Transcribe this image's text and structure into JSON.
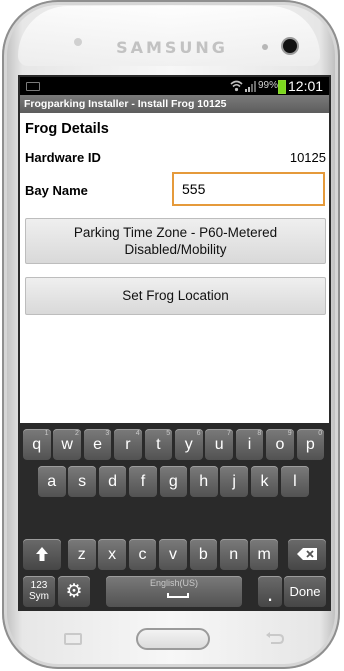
{
  "device": {
    "brand": "SAMSUNG"
  },
  "status_bar": {
    "battery": "99%",
    "time": "12:01"
  },
  "app": {
    "title": "Frogparking Installer - Install Frog 10125"
  },
  "form": {
    "section_title": "Frog Details",
    "hardware_id_label": "Hardware ID",
    "hardware_id_value": "10125",
    "bay_name_label": "Bay Name",
    "bay_name_value": "555"
  },
  "buttons": {
    "zone_line1": "Parking Time Zone - P60-Metered",
    "zone_line2": "Disabled/Mobility",
    "set_location": "Set Frog Location"
  },
  "keyboard": {
    "row1": [
      {
        "k": "q",
        "s": "1"
      },
      {
        "k": "w",
        "s": "2"
      },
      {
        "k": "e",
        "s": "3"
      },
      {
        "k": "r",
        "s": "4"
      },
      {
        "k": "t",
        "s": "5"
      },
      {
        "k": "y",
        "s": "6"
      },
      {
        "k": "u",
        "s": "7"
      },
      {
        "k": "i",
        "s": "8"
      },
      {
        "k": "o",
        "s": "9"
      },
      {
        "k": "p",
        "s": "0"
      }
    ],
    "row2": [
      "a",
      "s",
      "d",
      "f",
      "g",
      "h",
      "j",
      "k",
      "l"
    ],
    "row3": [
      "z",
      "x",
      "c",
      "v",
      "b",
      "n",
      "m"
    ],
    "sym_line1": "123",
    "sym_line2": "Sym",
    "space_label": "English(US)",
    "dot": ".",
    "done": "Done",
    "accent": "#ffffff"
  }
}
